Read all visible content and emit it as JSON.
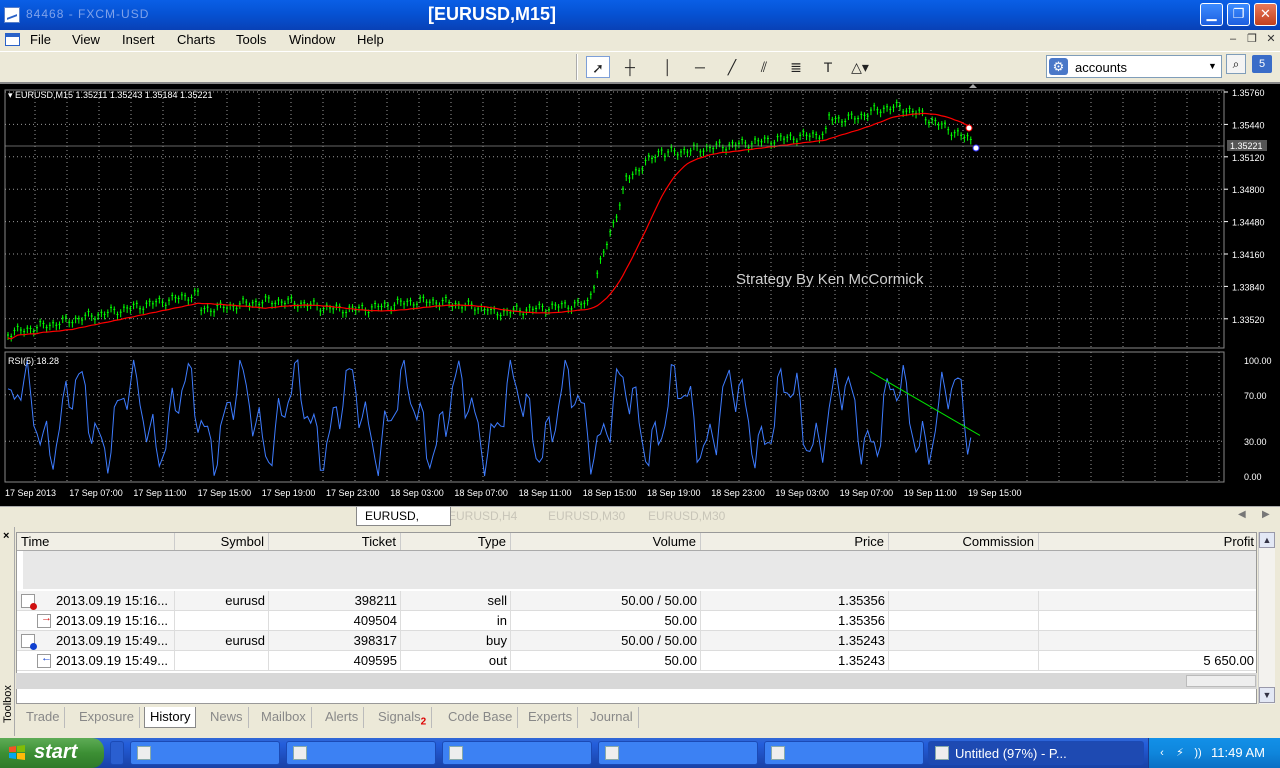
{
  "window": {
    "title": "[EURUSD,M15]",
    "ghost_title": "84468 - FXCM-USD"
  },
  "menu": [
    "File",
    "View",
    "Insert",
    "Charts",
    "Tools",
    "Window",
    "Help"
  ],
  "search": {
    "value": "accounts",
    "badge": "5"
  },
  "chart": {
    "header": "EURUSD,M15  1.35211 1.35243 1.35184 1.35221",
    "watermark": "Strategy By Ken McCormick",
    "price_ticks": [
      "1.35760",
      "1.35440",
      "1.35120",
      "1.34800",
      "1.34480",
      "1.34160",
      "1.33840",
      "1.33520"
    ],
    "current_price": "1.35221",
    "rsi_label": "RSI(5) 18.28",
    "rsi_ticks": [
      "100.00",
      "70.00",
      "30.00",
      "0.00"
    ],
    "time_labels": [
      "17 Sep 2013",
      "17 Sep 07:00",
      "17 Sep 11:00",
      "17 Sep 15:00",
      "17 Sep 19:00",
      "17 Sep 23:00",
      "18 Sep 03:00",
      "18 Sep 07:00",
      "18 Sep 11:00",
      "18 Sep 15:00",
      "18 Sep 19:00",
      "18 Sep 23:00",
      "19 Sep 03:00",
      "19 Sep 07:00",
      "19 Sep 11:00",
      "19 Sep 15:00"
    ],
    "colors": {
      "candles": "#00ff00",
      "ma": "#ff0000",
      "rsi": "#3e7cff",
      "trend": "#00e000",
      "grid": "#9a9a9a",
      "axis_text": "#ffffff"
    }
  },
  "chart_tabs": {
    "active": "EURUSD,",
    "others": [
      "EURUSD,H4",
      "EURUSD,M30",
      "EURUSD,M30"
    ]
  },
  "history": {
    "columns": [
      "Time",
      "Symbol",
      "Ticket",
      "Type",
      "Volume",
      "Price",
      "Commission",
      "Profit"
    ],
    "rows": [
      {
        "time": "2013.09.19 15:16...",
        "symbol": "eurusd",
        "ticket": "398211",
        "type": "sell",
        "volume": "50.00 / 50.00",
        "price": "1.35356",
        "commission": "",
        "profit": "",
        "icon": "order-sell-icon"
      },
      {
        "time": "2013.09.19 15:16...",
        "symbol": "",
        "ticket": "409504",
        "type": "in",
        "volume": "50.00",
        "price": "1.35356",
        "commission": "",
        "profit": "",
        "icon": "deal-in-icon"
      },
      {
        "time": "2013.09.19 15:49...",
        "symbol": "eurusd",
        "ticket": "398317",
        "type": "buy",
        "volume": "50.00 / 50.00",
        "price": "1.35243",
        "commission": "",
        "profit": "",
        "icon": "order-buy-icon"
      },
      {
        "time": "2013.09.19 15:49...",
        "symbol": "",
        "ticket": "409595",
        "type": "out",
        "volume": "50.00",
        "price": "1.35243",
        "commission": "",
        "profit": "5 650.00",
        "icon": "deal-out-icon"
      }
    ]
  },
  "toolbox": {
    "label": "Toolbox",
    "tabs": [
      "Trade",
      "Exposure",
      "History",
      "News",
      "Mailbox",
      "Alerts",
      "Signals",
      "Code Base",
      "Experts",
      "Journal"
    ],
    "signals_badge": "2",
    "active_tab": "History"
  },
  "taskbar": {
    "start": "start",
    "active_task": "Untitled (97%) - P...",
    "clock": "11:49 AM"
  }
}
